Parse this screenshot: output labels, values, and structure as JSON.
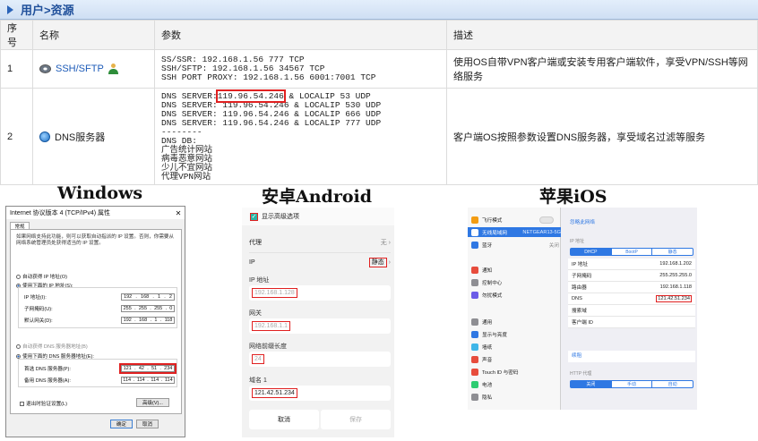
{
  "header": {
    "title": "用户>资源"
  },
  "table": {
    "headers": [
      "序号",
      "名称",
      "参数",
      "描述"
    ],
    "rows": [
      {
        "index": "1",
        "name": "SSH/SFTP",
        "params": [
          "SS/SSR: 192.168.1.56 777 TCP",
          "SSH/SFTP: 192.168.1.56 34567 TCP",
          "SSH PORT PROXY: 192.168.1.56 6001:7001 TCP"
        ],
        "desc": "使用OS自带VPN客户端或安装专用客户端软件，享受VPN/SSH等网络服务"
      },
      {
        "index": "2",
        "name": "DNS服务器",
        "dns_prefix": "DNS SERVER:",
        "dns_ip": "119.96.54.246",
        "dns_suffix": " & LOCALIP 53 UDP",
        "params": [
          "DNS SERVER: 119.96.54.246 & LOCALIP 530 UDP",
          "DNS SERVER: 119.96.54.246 & LOCALIP 666 UDP",
          "DNS SERVER: 119.96.54.246 & LOCALIP 777 UDP",
          "--------",
          "DNS DB:",
          "广告统计网站",
          "病毒恶意网站",
          "少儿不宜网站",
          "代理VPN网站"
        ],
        "desc": "客户端OS按照参数设置DNS服务器，享受域名过滤等服务"
      }
    ]
  },
  "platforms": {
    "windows": "Windows",
    "android": "安卓Android",
    "ios": "苹果iOS"
  },
  "windows_dialog": {
    "title": "Internet 协议版本 4 (TCP/IPv4) 属性",
    "tab": "常规",
    "desc": "如果网络支持此功能，则可以获取自动指派的 IP 设置。否则，你需要从网络系统管理员处获得适当的 IP 设置。",
    "auto_ip": "自动获得 IP 地址(O)",
    "manual_ip": "使用下面的 IP 地址(S):",
    "ip_label": "IP 地址(I):",
    "ip_value": [
      "192",
      "168",
      "1",
      "2"
    ],
    "mask_label": "子网掩码(U):",
    "mask_value": [
      "255",
      "255",
      "255",
      "0"
    ],
    "gw_label": "默认网关(D):",
    "gw_value": [
      "192",
      "168",
      "1",
      "118"
    ],
    "auto_dns": "自动获得 DNS 服务器地址(B)",
    "manual_dns": "使用下面的 DNS 服务器地址(E):",
    "dns1_label": "首选 DNS 服务器(P):",
    "dns1_value": [
      "121",
      "42",
      "51",
      "234"
    ],
    "dns2_label": "备用 DNS 服务器(A):",
    "dns2_value": [
      "114",
      "114",
      "114",
      "114"
    ],
    "validate": "退出时验证设置(L)",
    "advanced": "高级(V)...",
    "ok": "确定",
    "cancel": "取消"
  },
  "android": {
    "show_advanced": "显示高级选项",
    "proxy_label": "代理",
    "proxy_value": "无",
    "ip_label": "IP",
    "ip_value": "静态",
    "ip_addr_label": "IP 地址",
    "ip_addr_value": "192.168.1.128",
    "gw_label": "网关",
    "gw_value": "192.168.1.1",
    "prefix_label": "网络前缀长度",
    "prefix_value": "24",
    "dns1_label": "域名 1",
    "dns1_value": "121.42.51.234",
    "cancel": "取消",
    "save": "保存"
  },
  "ios": {
    "side": [
      {
        "label": "飞行模式",
        "color": "#f39c12",
        "right": ""
      },
      {
        "label": "无线局域网",
        "color": "#2f78e3",
        "right": "NETGEAR13-5G"
      },
      {
        "label": "蓝牙",
        "color": "#2f78e3",
        "right": "关闭"
      },
      {
        "label": "通知",
        "color": "#e74c3c",
        "right": ""
      },
      {
        "label": "控制中心",
        "color": "#8e8e93",
        "right": ""
      },
      {
        "label": "勿扰模式",
        "color": "#6c5ce7",
        "right": ""
      },
      {
        "label": "通用",
        "color": "#8e8e93",
        "right": ""
      },
      {
        "label": "显示与亮度",
        "color": "#2f78e3",
        "right": ""
      },
      {
        "label": "墙纸",
        "color": "#3fb6e8",
        "right": ""
      },
      {
        "label": "声音",
        "color": "#e74c3c",
        "right": ""
      },
      {
        "label": "Touch ID 与密码",
        "color": "#e74c3c",
        "right": ""
      },
      {
        "label": "电池",
        "color": "#2ecc71",
        "right": ""
      },
      {
        "label": "隐私",
        "color": "#8e8e93",
        "right": ""
      }
    ],
    "forget": "忽略此网络",
    "ip_section": "IP 地址",
    "seg": [
      "DHCP",
      "BootP",
      "静态"
    ],
    "fields": [
      {
        "k": "IP 地址",
        "v": "192.168.1.202"
      },
      {
        "k": "子网掩码",
        "v": "255.255.255.0"
      },
      {
        "k": "路由器",
        "v": "192.168.1.118"
      },
      {
        "k": "DNS",
        "v": "121.42.51.234"
      },
      {
        "k": "搜索域",
        "v": ""
      },
      {
        "k": "客户端 ID",
        "v": ""
      }
    ],
    "renew": "续租",
    "proxy_section": "HTTP 代理",
    "proxy_seg": [
      "关闭",
      "手动",
      "自动"
    ]
  }
}
